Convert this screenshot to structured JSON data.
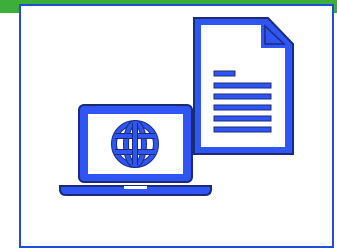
{
  "colors": {
    "accent_green": "#3cae3a",
    "icon_blue": "#2f55f5",
    "outline_navy": "#1a2b7a",
    "frame_blue": "#1f4ed8",
    "background": "#ffffff"
  },
  "icons": {
    "document": "document-icon",
    "laptop": "laptop-icon",
    "globe": "globe-icon"
  }
}
